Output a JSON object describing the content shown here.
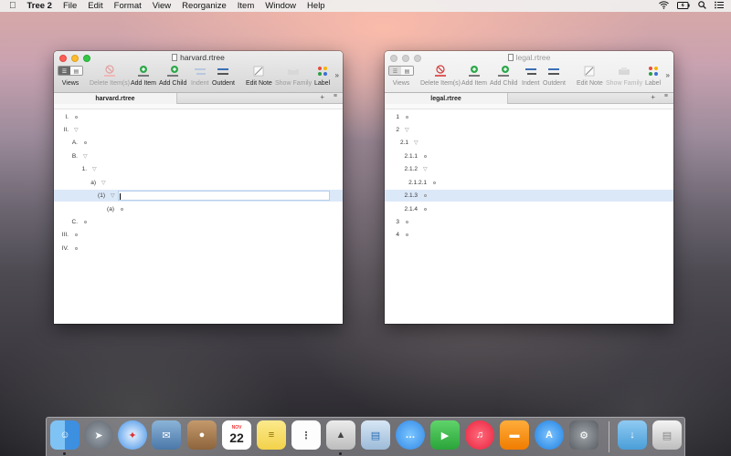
{
  "menubar": {
    "app_name": "Tree 2",
    "items": [
      "File",
      "Edit",
      "Format",
      "View",
      "Reorganize",
      "Item",
      "Window",
      "Help"
    ],
    "apple": "",
    "status_icons": [
      "wifi-icon",
      "battery-icon",
      "search-icon",
      "notification-center-icon"
    ]
  },
  "toolbar_labels": {
    "views": "Views",
    "delete": "Delete Item(s)",
    "add_item": "Add Item",
    "add_child": "Add Child",
    "indent": "Indent",
    "outdent": "Outdent",
    "edit_note": "Edit Note",
    "show_family": "Show Family",
    "label": "Label",
    "more": "»"
  },
  "left_window": {
    "title": "harvard.rtree",
    "tab": "harvard.rtree",
    "rows": [
      {
        "label": "I.",
        "marker": "dot"
      },
      {
        "label": "II.",
        "marker": "tri"
      },
      {
        "label": "A.",
        "marker": "dot"
      },
      {
        "label": "B.",
        "marker": "tri"
      },
      {
        "label": "1.",
        "marker": "tri"
      },
      {
        "label": "a)",
        "marker": "tri"
      },
      {
        "label": "(1)",
        "marker": "tri",
        "selected": true
      },
      {
        "label": "(a)",
        "marker": "dot"
      },
      {
        "label": "C.",
        "marker": "dot"
      },
      {
        "label": "III.",
        "marker": "dot"
      },
      {
        "label": "IV.",
        "marker": "dot"
      }
    ]
  },
  "right_window": {
    "title": "legal.rtree",
    "tab": "legal.rtree",
    "rows": [
      {
        "label": "1",
        "marker": "dot"
      },
      {
        "label": "2",
        "marker": "tri"
      },
      {
        "label": "2.1",
        "marker": "tri"
      },
      {
        "label": "2.1.1",
        "marker": "dot"
      },
      {
        "label": "2.1.2",
        "marker": "tri"
      },
      {
        "label": "2.1.2.1",
        "marker": "dot"
      },
      {
        "label": "2.1.3",
        "marker": "dot",
        "selected": true
      },
      {
        "label": "2.1.4",
        "marker": "dot"
      },
      {
        "label": "3",
        "marker": "dot"
      },
      {
        "label": "4",
        "marker": "dot"
      }
    ]
  },
  "dock": {
    "apps": [
      "finder-icon",
      "launchpad-icon",
      "safari-icon",
      "mail-icon",
      "contacts-icon",
      "calendar-icon",
      "notes-icon",
      "reminders-icon",
      "tree-icon",
      "preview-icon",
      "messages-icon",
      "facetime-icon",
      "itunes-icon",
      "ibooks-icon",
      "app-store-icon",
      "system-preferences-icon",
      "downloads-folder-icon",
      "trash-icon"
    ],
    "calendar_month": "NOV",
    "calendar_day": "22"
  }
}
